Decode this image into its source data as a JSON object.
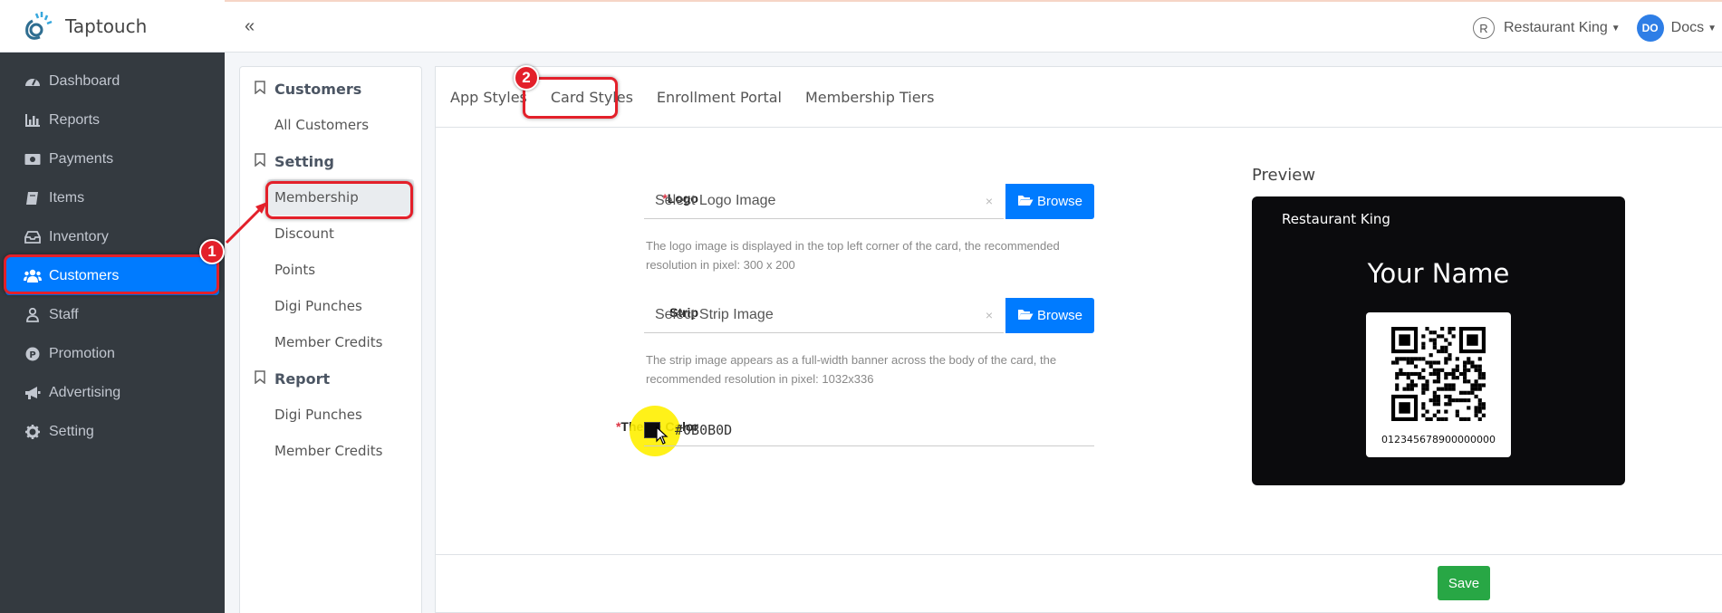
{
  "brand": {
    "name": "Taptouch"
  },
  "sidebar": {
    "items": [
      {
        "label": "Dashboard",
        "icon": "tachometer-icon"
      },
      {
        "label": "Reports",
        "icon": "bar-chart-icon"
      },
      {
        "label": "Payments",
        "icon": "money-icon"
      },
      {
        "label": "Items",
        "icon": "book-icon"
      },
      {
        "label": "Inventory",
        "icon": "inbox-icon"
      },
      {
        "label": "Customers",
        "icon": "users-icon",
        "active": true
      },
      {
        "label": "Staff",
        "icon": "user-tie-icon"
      },
      {
        "label": "Promotion",
        "icon": "p-circle-icon"
      },
      {
        "label": "Advertising",
        "icon": "bullhorn-icon"
      },
      {
        "label": "Setting",
        "icon": "gear-icon"
      }
    ]
  },
  "topbar": {
    "collapse": "«",
    "restaurant_initial": "R",
    "restaurant": "Restaurant King",
    "user_initials": "DO",
    "user": "Docs"
  },
  "submenu": {
    "customers_head": "Customers",
    "all_customers": "All Customers",
    "setting_head": "Setting",
    "membership": "Membership",
    "discount": "Discount",
    "points": "Points",
    "digi_punches": "Digi Punches",
    "member_credits": "Member Credits",
    "report_head": "Report",
    "report_digi_punches": "Digi Punches",
    "report_member_credits": "Member Credits"
  },
  "tabs": {
    "app_styles": "App Styles",
    "card_styles": "Card Styles",
    "enrollment_portal": "Enrollment Portal",
    "membership_tiers": "Membership Tiers"
  },
  "form": {
    "required_mark": "*",
    "logo_label": "Logo",
    "logo_placeholder": "Select Logo Image",
    "logo_help": "The logo image is displayed in the top left corner of the card, the recommended resolution in pixel: 300 x 200",
    "strip_label": "Strip",
    "strip_placeholder": "Select Strip Image",
    "strip_help": "The strip image appears as a full-width banner across the body of the card, the recommended resolution in pixel: 1032x336",
    "browse_label": "Browse",
    "clear_glyph": "×",
    "theme_color_label": "Theme Color",
    "theme_color_value": "#0B0B0D"
  },
  "preview": {
    "title": "Preview",
    "brand": "Restaurant King",
    "name": "Your Name",
    "code": "012345678900000000"
  },
  "footer": {
    "save_label": "Save"
  },
  "annotations": {
    "step1": "1",
    "step2": "2"
  },
  "colors": {
    "primary": "#007bff",
    "sidebar": "#343a40",
    "save": "#28a745",
    "highlight": "#e3202a",
    "theme": "#0B0B0D"
  }
}
